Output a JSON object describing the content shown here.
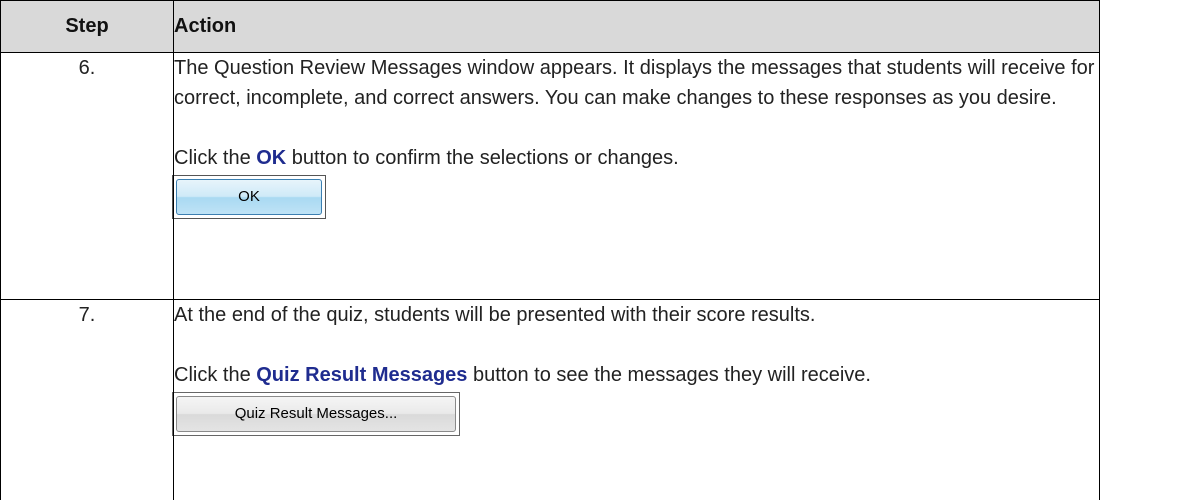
{
  "table": {
    "headers": {
      "step": "Step",
      "action": "Action"
    },
    "rows": [
      {
        "step": "6.",
        "paragraph1": "The Question Review Messages window appears.  It displays the messages that students will receive for correct, incomplete, and correct answers.  You can make changes to these responses as you desire.",
        "instruction_prefix": "Click the ",
        "instruction_highlight": "OK",
        "instruction_suffix": " button to confirm the selections or changes.",
        "button_label": "OK"
      },
      {
        "step": "7.",
        "paragraph1": "At the end of the quiz, students will be presented with their score results.",
        "instruction_prefix": "Click the ",
        "instruction_highlight": "Quiz Result Messages",
        "instruction_suffix": " button to see the messages they will receive.",
        "button_label": "Quiz Result Messages..."
      }
    ]
  },
  "colors": {
    "header_background": "#d9d9d9",
    "highlight_text": "#1f2c8f",
    "border": "#000000"
  }
}
